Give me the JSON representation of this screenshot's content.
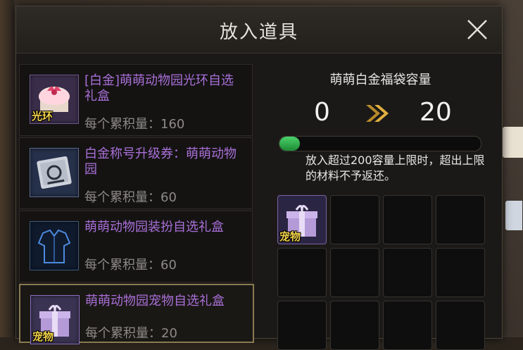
{
  "dialog": {
    "title": "放入道具"
  },
  "items": [
    {
      "name": "[白金]萌萌动物园光环自选礼盒",
      "accum": "每个累积量：160",
      "tag": "光环",
      "icon": "gift-box-icon",
      "selected": false
    },
    {
      "name": "白金称号升级券：萌萌动物园",
      "accum": "每个累积量：60",
      "tag": "",
      "icon": "title-ticket-icon",
      "selected": false
    },
    {
      "name": "萌萌动物园装扮自选礼盒",
      "accum": "每个累积量：60",
      "tag": "",
      "icon": "costume-icon",
      "selected": false
    },
    {
      "name": "萌萌动物园宠物自选礼盒",
      "accum": "每个累积量：20",
      "tag": "宠物",
      "icon": "pet-gift-box-icon",
      "selected": true
    }
  ],
  "capacity": {
    "title": "萌萌白金福袋容量",
    "from": "0",
    "to": "20",
    "progress": 0.1,
    "note": "放入超过200容量上限时，超出上限的材料不予返还。",
    "colors": {
      "fill": "#3cc05a",
      "item_name": "#a96fd8",
      "tag": "#f1d24a"
    }
  },
  "slots": [
    {
      "tag": "宠物",
      "icon": "pet-gift-box-icon"
    },
    {},
    {},
    {},
    {},
    {},
    {},
    {},
    {},
    {},
    {},
    {}
  ]
}
